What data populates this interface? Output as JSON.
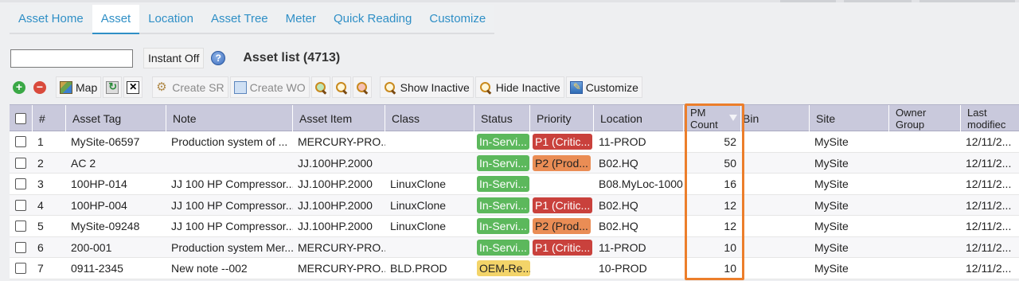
{
  "tabs": [
    {
      "label": "Asset Home",
      "active": false
    },
    {
      "label": "Asset",
      "active": true
    },
    {
      "label": "Location",
      "active": false
    },
    {
      "label": "Asset Tree",
      "active": false
    },
    {
      "label": "Meter",
      "active": false
    },
    {
      "label": "Quick Reading",
      "active": false
    },
    {
      "label": "Customize",
      "active": false
    }
  ],
  "search": {
    "value": "",
    "placeholder": ""
  },
  "instant_label": "Instant Off",
  "help_icon": "?",
  "list_title": "Asset list (4713)",
  "toolbar": {
    "add_icon": "+",
    "remove_icon": "−",
    "map_label": "Map",
    "close_icon": "✕",
    "create_sr_label": "Create SR",
    "create_wo_label": "Create WO",
    "show_inactive_label": "Show Inactive",
    "hide_inactive_label": "Hide Inactive",
    "customize_label": "Customize"
  },
  "columns": {
    "num": "#",
    "asset_tag": "Asset Tag",
    "note": "Note",
    "asset_item": "Asset Item",
    "class": "Class",
    "status": "Status",
    "priority": "Priority",
    "location": "Location",
    "pm_count_1": "PM",
    "pm_count_2": "Count",
    "bin": "Bin",
    "site": "Site",
    "owner_group_1": "Owner",
    "owner_group_2": "Group",
    "last_modified_1": "Last",
    "last_modified_2": "modifiec"
  },
  "rows": [
    {
      "num": "1",
      "tag": "MySite-06597",
      "note": "Production system of ...",
      "item": "MERCURY-PRO...",
      "class": "",
      "status": "In-Servi...",
      "status_color": "green",
      "priority": "P1 (Critic...",
      "priority_color": "red",
      "location": "11-PROD",
      "pm": "52",
      "bin": "",
      "site": "MySite",
      "owner": "",
      "modified": "12/11/2..."
    },
    {
      "num": "2",
      "tag": "AC 2",
      "note": "",
      "item": "JJ.100HP.2000",
      "class": "",
      "status": "In-Servi...",
      "status_color": "green",
      "priority": "P2 (Prod...",
      "priority_color": "orange",
      "location": "B02.HQ",
      "pm": "50",
      "bin": "",
      "site": "MySite",
      "owner": "",
      "modified": "12/11/2..."
    },
    {
      "num": "3",
      "tag": "100HP-014",
      "note": "JJ 100 HP Compressor...",
      "item": "JJ.100HP.2000",
      "class": "LinuxClone",
      "status": "In-Servi...",
      "status_color": "green",
      "priority": "",
      "priority_color": "",
      "location": "B08.MyLoc-1000",
      "pm": "16",
      "bin": "",
      "site": "MySite",
      "owner": "",
      "modified": "12/11/2..."
    },
    {
      "num": "4",
      "tag": "100HP-004",
      "note": "JJ 100 HP Compressor...",
      "item": "JJ.100HP.2000",
      "class": "LinuxClone",
      "status": "In-Servi...",
      "status_color": "green",
      "priority": "P1 (Critic...",
      "priority_color": "red",
      "location": "B02.HQ",
      "pm": "12",
      "bin": "",
      "site": "MySite",
      "owner": "",
      "modified": "12/11/2..."
    },
    {
      "num": "5",
      "tag": "MySite-09248",
      "note": "JJ 100 HP Compressor...",
      "item": "JJ.100HP.2000",
      "class": "LinuxClone",
      "status": "In-Servi...",
      "status_color": "green",
      "priority": "P2 (Prod...",
      "priority_color": "orange",
      "location": "B02.HQ",
      "pm": "12",
      "bin": "",
      "site": "MySite",
      "owner": "",
      "modified": "12/11/2..."
    },
    {
      "num": "6",
      "tag": "200-001",
      "note": "Production system Mer...",
      "item": "MERCURY-PRO...",
      "class": "",
      "status": "In-Servi...",
      "status_color": "green",
      "priority": "P1 (Critic...",
      "priority_color": "red",
      "location": "11-PROD",
      "pm": "10",
      "bin": "",
      "site": "MySite",
      "owner": "",
      "modified": "12/11/2..."
    },
    {
      "num": "7",
      "tag": "0911-2345",
      "note": "New note --002",
      "item": "MERCURY-PRO...",
      "class": "BLD.PROD",
      "status": "OEM-Re...",
      "status_color": "yellow",
      "priority": "",
      "priority_color": "",
      "location": "10-PROD",
      "pm": "10",
      "bin": "",
      "site": "MySite",
      "owner": "",
      "modified": "12/11/2..."
    }
  ],
  "colors": {
    "accent": "#2f8fc6",
    "header_bg": "#c9c9dc",
    "highlight": "#ec7e2b"
  }
}
